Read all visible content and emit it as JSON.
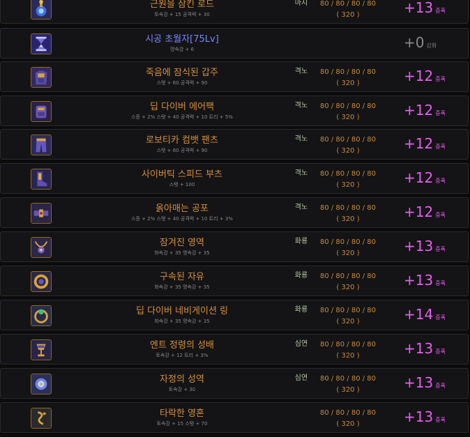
{
  "colors": {
    "legendary_name": "#d48f3a",
    "epic_name": "#7b86ff",
    "stars_pink": "#e85ef0",
    "muted": "#8a8a8a",
    "stat_values": "#c78a3c",
    "tag": "#b9c8a8"
  },
  "items": [
    {
      "name": "근원을 삼킨 로드",
      "stats": "토속강 + 15 공격력 + 30",
      "tag": "마지",
      "values": "80 / 80 / 80 / 80",
      "sum": "( 320 )",
      "enh": "+13",
      "enh_label": "증폭",
      "icon": "rod-icon",
      "gray": false,
      "blue": false
    },
    {
      "name": "시공 초월자[75Lv]",
      "stats": "명속강 + 6",
      "tag": "",
      "values": "",
      "sum": "",
      "enh": "+0",
      "enh_label": "강화",
      "icon": "hourglass-icon",
      "gray": true,
      "blue": true
    },
    {
      "name": "죽음에 잠식된 갑주",
      "stats": "스탯 + 60 공격력 + 90",
      "tag": "격노",
      "values": "80 / 80 / 80 / 80",
      "sum": "( 320 )",
      "enh": "+12",
      "enh_label": "증폭",
      "icon": "armor-icon",
      "gray": false,
      "blue": false
    },
    {
      "name": "딥 다이버 에어팩",
      "stats": "스증 + 2% 스탯 + 40 공격력 + 10 트리 + 5%",
      "tag": "격노",
      "values": "80 / 80 / 80 / 80",
      "sum": "( 320 )",
      "enh": "+12",
      "enh_label": "증폭",
      "icon": "airpack-icon",
      "gray": false,
      "blue": false
    },
    {
      "name": "로보티카 컴뱃 팬츠",
      "stats": "스탯 + 60 공격력 + 90",
      "tag": "격노",
      "values": "80 / 80 / 80 / 80",
      "sum": "( 320 )",
      "enh": "+12",
      "enh_label": "증폭",
      "icon": "pants-icon",
      "gray": false,
      "blue": false
    },
    {
      "name": "사이버틱 스피드 부츠",
      "stats": "스탯 + 100",
      "tag": "격노",
      "values": "80 / 80 / 80 / 80",
      "sum": "( 320 )",
      "enh": "+12",
      "enh_label": "증폭",
      "icon": "boots-icon",
      "gray": false,
      "blue": false
    },
    {
      "name": "옭아매는 공포",
      "stats": "스증 + 2% 스탯 + 40 공격력 + 10 트리 + 3%",
      "tag": "격노",
      "values": "80 / 80 / 80 / 80",
      "sum": "( 320 )",
      "enh": "+12",
      "enh_label": "증폭",
      "icon": "belt-icon",
      "gray": false,
      "blue": false
    },
    {
      "name": "잠겨진 영역",
      "stats": "화속강 + 35 명속강 + 35",
      "tag": "화룡",
      "values": "80 / 80 / 80 / 80",
      "sum": "( 320 )",
      "enh": "+13",
      "enh_label": "증폭",
      "icon": "necklace-icon",
      "gray": false,
      "blue": false
    },
    {
      "name": "구속된 자유",
      "stats": "화속강 + 35 명속강 + 35",
      "tag": "화룡",
      "values": "80 / 80 / 80 / 80",
      "sum": "( 320 )",
      "enh": "+13",
      "enh_label": "증폭",
      "icon": "bracelet-icon",
      "gray": false,
      "blue": false
    },
    {
      "name": "딥 다이버 네비게이션 링",
      "stats": "화속강 + 35 명속강 + 35",
      "tag": "화룡",
      "values": "80 / 80 / 80 / 80",
      "sum": "( 320 )",
      "enh": "+14",
      "enh_label": "증폭",
      "icon": "ring-icon",
      "gray": false,
      "blue": false
    },
    {
      "name": "엔트 정령의 성배",
      "stats": "토속강 + 12 트리 + 3%",
      "tag": "심연",
      "values": "80 / 80 / 80 / 80",
      "sum": "( 320 )",
      "enh": "+13",
      "enh_label": "증폭",
      "icon": "grail-icon",
      "gray": false,
      "blue": false
    },
    {
      "name": "자정의 성역",
      "stats": "토속강 + 30",
      "tag": "심연",
      "values": "80 / 80 / 80 / 80",
      "sum": "( 320 )",
      "enh": "+13",
      "enh_label": "증폭",
      "icon": "sanctuary-icon",
      "gray": false,
      "blue": false
    },
    {
      "name": "타락한 영혼",
      "stats": "토속강 + 15 스탯 + 70",
      "tag": "",
      "values": "80 / 80 / 80 / 80",
      "sum": "( 320 )",
      "enh": "+13",
      "enh_label": "증폭",
      "icon": "soul-icon",
      "gray": false,
      "blue": false
    }
  ]
}
